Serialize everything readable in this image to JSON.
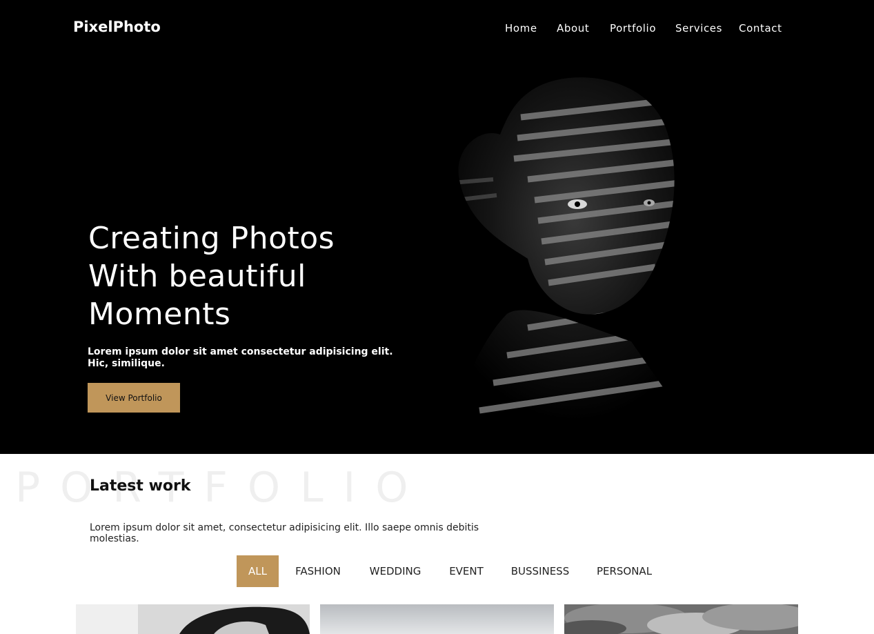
{
  "brand": {
    "name": "PixelPhoto",
    "accent": "#c0965a"
  },
  "nav": {
    "items": [
      {
        "label": "Home"
      },
      {
        "label": "About"
      },
      {
        "label": "Portfolio"
      },
      {
        "label": "Services"
      },
      {
        "label": "Contact"
      }
    ]
  },
  "hero": {
    "title_lines": [
      "Creating Photos",
      "With beautiful",
      "Moments"
    ],
    "subtitle": "Lorem ipsum dolor sit amet consectetur adipisicing elit. Hic, similique.",
    "button_label": "View Portfolio",
    "image_description_icon": "portrait-photo"
  },
  "portfolio": {
    "background_word": "PORTFOLIO",
    "title": "Latest work",
    "description": "Lorem ipsum dolor sit amet, consectetur adipisicing elit. Illo saepe omnis debitis molestias.",
    "filters": [
      {
        "label": "ALL",
        "active": true
      },
      {
        "label": "FASHION",
        "active": false
      },
      {
        "label": "WEDDING",
        "active": false
      },
      {
        "label": "EVENT",
        "active": false
      },
      {
        "label": "BUSSINESS",
        "active": false
      },
      {
        "label": "PERSONAL",
        "active": false
      }
    ],
    "thumbnails": [
      {
        "icon": "woman-portrait-photo"
      },
      {
        "icon": "sky-photo"
      },
      {
        "icon": "cloud-photo"
      }
    ]
  }
}
